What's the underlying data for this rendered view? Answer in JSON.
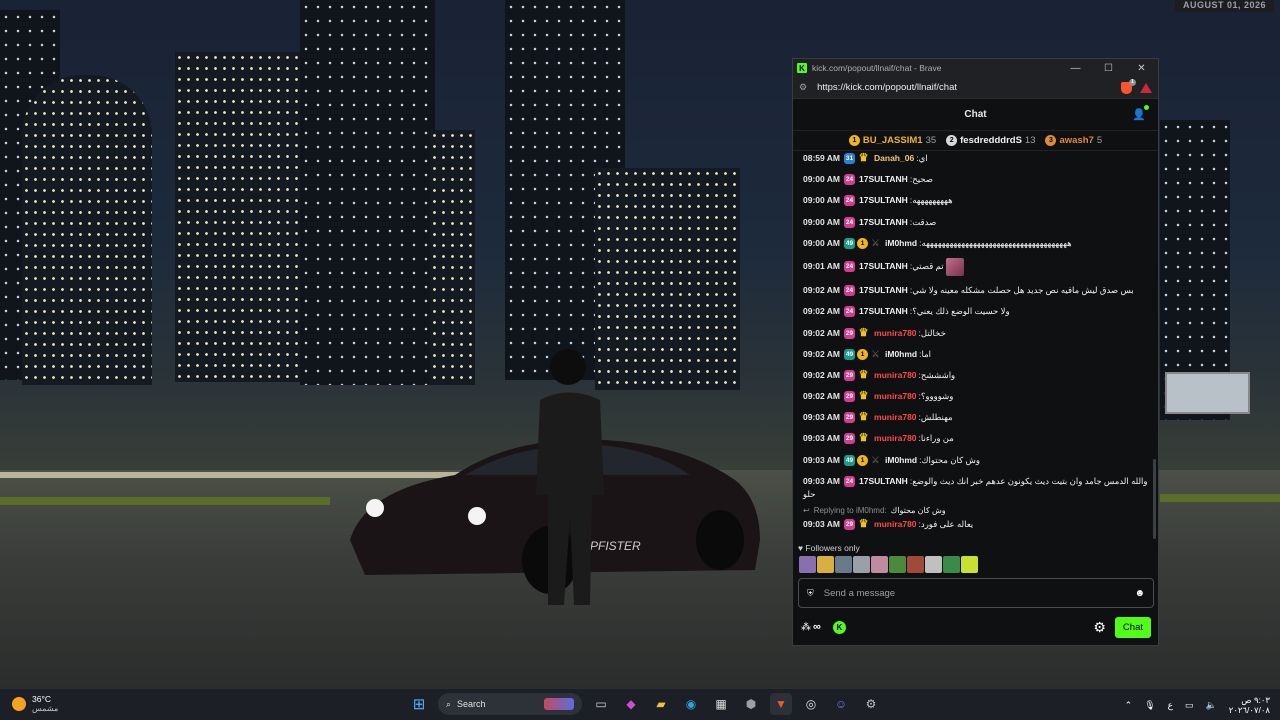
{
  "scene": {
    "date_badge": "AUGUST 01, 2026"
  },
  "browser": {
    "title": "kick.com/popout/llnaif/chat - Brave",
    "url": "https://kick.com/popout/llnaif/chat",
    "controls": {
      "minimize": "—",
      "maximize": "☐",
      "close": "✕"
    }
  },
  "chat": {
    "header": "Chat",
    "leaderboard": [
      {
        "rank": "1",
        "name": "BU_JASSIM1",
        "count": "35",
        "color": "#f0b41e"
      },
      {
        "rank": "2",
        "name": "fesdredddrdS",
        "count": "13",
        "color": "#d8d8d8"
      },
      {
        "rank": "3",
        "name": "awash7",
        "count": "5",
        "color": "#e08a3c"
      }
    ],
    "messages": [
      {
        "time": "08:59 AM",
        "badge": "31",
        "badge_color": "blue",
        "crown": true,
        "user": "Danah_06",
        "user_color": "#f5c77a",
        "text": "اي"
      },
      {
        "time": "09:00 AM",
        "badge": "24",
        "badge_color": "pink",
        "crown": false,
        "user": "17SULTANH",
        "user_color": "#f0f0f0",
        "text": "صحيح"
      },
      {
        "time": "09:00 AM",
        "badge": "24",
        "badge_color": "pink",
        "crown": false,
        "user": "17SULTANH",
        "user_color": "#f0f0f0",
        "text": "هههههههههه"
      },
      {
        "time": "09:00 AM",
        "badge": "24",
        "badge_color": "pink",
        "crown": false,
        "user": "17SULTANH",
        "user_color": "#f0f0f0",
        "text": "صدقت"
      },
      {
        "time": "09:00 AM",
        "badge": "49",
        "badge_color": "teal",
        "gold": "1",
        "dim": true,
        "crown": false,
        "user": "iM0hmd",
        "user_color": "#f0f0f0",
        "text": "هههههههههههههههههههههههههههههههههههههه"
      },
      {
        "time": "09:01 AM",
        "badge": "24",
        "badge_color": "pink",
        "crown": false,
        "user": "17SULTANH",
        "user_color": "#f0f0f0",
        "text": "تم قصتي",
        "emote": true
      },
      {
        "time": "09:02 AM",
        "badge": "24",
        "badge_color": "pink",
        "crown": false,
        "user": "17SULTANH",
        "user_color": "#f0f0f0",
        "text": "بس صدق ليش مافيه نص جديد هل حصلت مشكله معينه ولا شي"
      },
      {
        "time": "09:02 AM",
        "badge": "24",
        "badge_color": "pink",
        "crown": false,
        "user": "17SULTANH",
        "user_color": "#f0f0f0",
        "text": "ولا حسيت الوضع ذلك يعني؟"
      },
      {
        "time": "09:02 AM",
        "badge": "29",
        "badge_color": "pink",
        "crown": true,
        "user": "munira780",
        "user_color": "#ff4a4a",
        "text": "خخالتل"
      },
      {
        "time": "09:02 AM",
        "badge": "49",
        "badge_color": "teal",
        "gold": "1",
        "dim": true,
        "crown": false,
        "user": "iM0hmd",
        "user_color": "#f0f0f0",
        "text": "اما"
      },
      {
        "time": "09:02 AM",
        "badge": "29",
        "badge_color": "pink",
        "crown": true,
        "user": "munira780",
        "user_color": "#ff4a4a",
        "text": "واشششح"
      },
      {
        "time": "09:02 AM",
        "badge": "29",
        "badge_color": "pink",
        "crown": true,
        "user": "munira780",
        "user_color": "#ff4a4a",
        "text": "وشوووو؟"
      },
      {
        "time": "09:03 AM",
        "badge": "29",
        "badge_color": "pink",
        "crown": true,
        "user": "munira780",
        "user_color": "#ff4a4a",
        "text": "مهنطلش"
      },
      {
        "time": "09:03 AM",
        "badge": "29",
        "badge_color": "pink",
        "crown": true,
        "user": "munira780",
        "user_color": "#ff4a4a",
        "text": "من وراءنا"
      },
      {
        "time": "09:03 AM",
        "badge": "49",
        "badge_color": "teal",
        "gold": "1",
        "dim": true,
        "crown": false,
        "user": "iM0hmd",
        "user_color": "#f0f0f0",
        "text": "وش كان محتواك"
      },
      {
        "time": "09:03 AM",
        "badge": "24",
        "badge_color": "pink",
        "crown": false,
        "user": "17SULTANH",
        "user_color": "#f0f0f0",
        "text": "والله الدمس جامد وان بتيت ديث يكونون عدهم خبر انك ديث والوضع حلو",
        "wrap": true
      }
    ],
    "reply": {
      "label": "Replying to iM0hmd:",
      "quote": "وش كان محتواك"
    },
    "last_message": {
      "time": "09:03 AM",
      "badge": "29",
      "user": "munira780",
      "user_color": "#ff4a4a",
      "text": "يعاله على فورد"
    },
    "followers_only": "Followers only",
    "input_placeholder": "Send a message",
    "send_label": "Chat",
    "infinity": "∞"
  },
  "taskbar": {
    "temp": "36°C",
    "condition": "مشمس",
    "search": "Search",
    "lang": "ع",
    "time": "٩:٠٣ ص",
    "date": "٢٠٢٦/٠٧/٠٨"
  }
}
